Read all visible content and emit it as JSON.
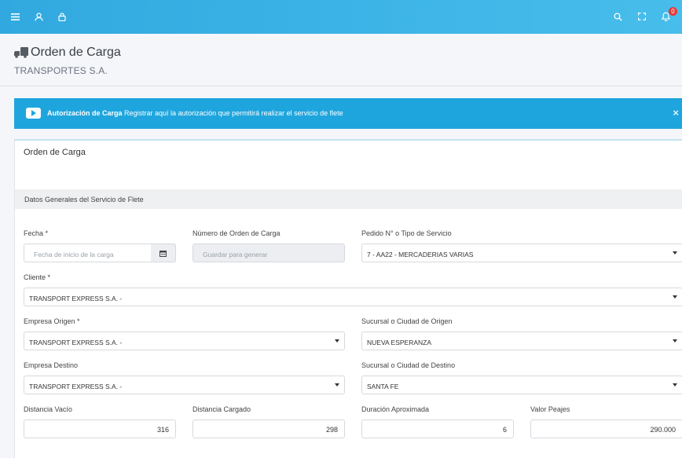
{
  "topbar": {
    "notifications_count": "0"
  },
  "header": {
    "title": "Orden de Carga",
    "subtitle": "TRANSPORTES S.A."
  },
  "alert": {
    "bold": "Autorización de Carga",
    "text": "Registrar aquí la autorización que permitirá realizar el servicio de flete",
    "close": "×"
  },
  "card": {
    "title": "Orden de Carga",
    "section": "Datos Generales del Servicio de Flete"
  },
  "form": {
    "fecha": {
      "label": "Fecha *",
      "placeholder": "Fecha de inicio de la carga"
    },
    "numero": {
      "label": "Número de Orden de Carga",
      "placeholder": "Guardar para generar"
    },
    "pedido": {
      "label": "Pedido N° o Tipo de Servicio",
      "value": "7 - AA22 - MERCADERIAS VARIAS"
    },
    "cliente": {
      "label": "Cliente *",
      "value": "TRANSPORT EXPRESS S.A. -"
    },
    "empresa_origen": {
      "label": "Empresa Origen *",
      "value": "TRANSPORT EXPRESS S.A. -"
    },
    "sucursal_origen": {
      "label": "Sucursal o Ciudad de Origen",
      "value": "NUEVA ESPERANZA"
    },
    "empresa_destino": {
      "label": "Empresa Destino",
      "value": "TRANSPORT EXPRESS S.A. -"
    },
    "sucursal_destino": {
      "label": "Sucursal o Ciudad de Destino",
      "value": "SANTA FE"
    },
    "distancia_vacio": {
      "label": "Distancia Vacío",
      "value": "316"
    },
    "distancia_cargado": {
      "label": "Distancia Cargado",
      "value": "298"
    },
    "duracion": {
      "label": "Duración Aproximada",
      "value": "6"
    },
    "peajes": {
      "label": "Valor Peajes",
      "value": "290.000"
    }
  }
}
